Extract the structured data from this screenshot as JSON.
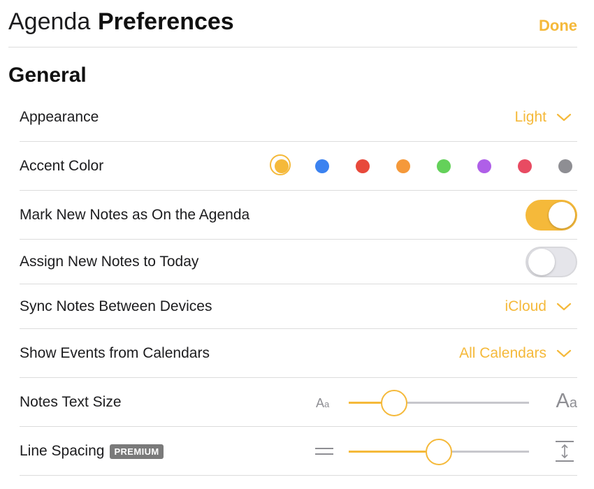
{
  "header": {
    "app_name": "Agenda",
    "title": "Preferences",
    "done_label": "Done"
  },
  "section": {
    "title": "General"
  },
  "colors": {
    "accent": "#f5b93a"
  },
  "rows": {
    "appearance": {
      "label": "Appearance",
      "value": "Light",
      "icon": "chevron-down-icon"
    },
    "accent_color": {
      "label": "Accent Color",
      "selected": "yellow",
      "swatches": [
        {
          "name": "yellow",
          "color": "#f5b93a"
        },
        {
          "name": "blue",
          "color": "#3b82f0"
        },
        {
          "name": "red",
          "color": "#e8493b"
        },
        {
          "name": "orange",
          "color": "#f5993a"
        },
        {
          "name": "green",
          "color": "#64d15a"
        },
        {
          "name": "purple",
          "color": "#af5fe8"
        },
        {
          "name": "pink",
          "color": "#e84b62"
        },
        {
          "name": "gray",
          "color": "#8e8e93"
        }
      ]
    },
    "mark_new_notes": {
      "label": "Mark New Notes as On the Agenda",
      "enabled": true
    },
    "assign_to_today": {
      "label": "Assign New Notes to Today",
      "enabled": false
    },
    "sync": {
      "label": "Sync Notes Between Devices",
      "value": "iCloud",
      "icon": "chevron-down-icon"
    },
    "calendars": {
      "label": "Show Events from Calendars",
      "value": "All Calendars",
      "icon": "chevron-down-icon"
    },
    "text_size": {
      "label": "Notes Text Size",
      "small_glyph": "A",
      "small_glyph_sub": "a",
      "large_glyph": "A",
      "large_glyph_sub": "a",
      "value_fraction": 0.25
    },
    "line_spacing": {
      "label": "Line Spacing",
      "badge": "PREMIUM",
      "min_icon": "line-spacing-tight-icon",
      "max_icon": "line-spacing-expand-icon",
      "value_fraction": 0.5
    }
  }
}
